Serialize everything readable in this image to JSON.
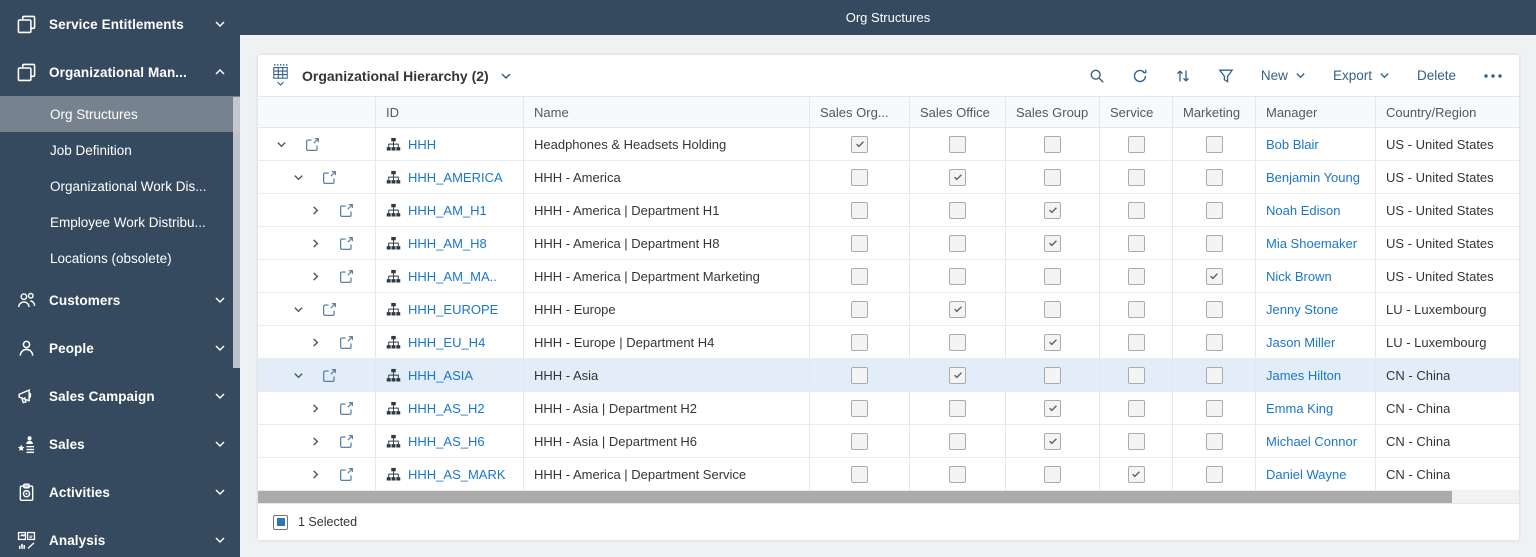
{
  "app": {
    "title": "Org Structures"
  },
  "colors": {
    "sidebar_bg": "#354A5F",
    "sidebar_selected": "#76838F",
    "topbar_bg": "#354A5F",
    "page_bg": "#F0F1F3",
    "link": "#1B77C8",
    "toolbar_accent": "#346187",
    "selected_row": "#E3EDF7",
    "border": "#E5E8EA",
    "text": "#32363A",
    "header_text": "#51585F",
    "check": "#54636D"
  },
  "sidebar": {
    "items": [
      {
        "label": "Service Entitlements",
        "icon": "documents",
        "expanded": false
      },
      {
        "label": "Organizational Man...",
        "icon": "documents",
        "expanded": true,
        "children": [
          {
            "label": "Org Structures",
            "selected": true
          },
          {
            "label": "Job Definition"
          },
          {
            "label": "Organizational Work Dis..."
          },
          {
            "label": "Employee Work Distribu..."
          },
          {
            "label": "Locations (obsolete)"
          }
        ]
      },
      {
        "label": "Customers",
        "icon": "customers",
        "expanded": false
      },
      {
        "label": "People",
        "icon": "person",
        "expanded": false
      },
      {
        "label": "Sales Campaign",
        "icon": "megaphone",
        "expanded": false
      },
      {
        "label": "Sales",
        "icon": "sales",
        "expanded": false
      },
      {
        "label": "Activities",
        "icon": "clipboard",
        "expanded": false
      },
      {
        "label": "Analysis",
        "icon": "analysis",
        "expanded": false
      }
    ]
  },
  "toolbar": {
    "view_switch_icon": "grid-view",
    "view_title": "Organizational Hierarchy (2)",
    "icon_buttons": [
      "search",
      "refresh",
      "sort",
      "filter"
    ],
    "new_label": "New",
    "export_label": "Export",
    "delete_label": "Delete",
    "overflow_icon": "overflow"
  },
  "table": {
    "columns": [
      "ID",
      "Name",
      "Sales Org...",
      "Sales Office",
      "Sales Group",
      "Service",
      "Marketing",
      "Manager",
      "Country/Region"
    ],
    "check_columns": [
      "Sales Org...",
      "Sales Office",
      "Sales Group",
      "Service",
      "Marketing"
    ],
    "row_icons": {
      "type": "org-chart",
      "open": "open-external"
    },
    "rows": [
      {
        "id": "HHH",
        "name": "Headphones & Headsets Holding",
        "level": 0,
        "expanded": true,
        "checked": 0,
        "manager": "Bob Blair",
        "country": "US - United States",
        "selected": false
      },
      {
        "id": "HHH_AMERICA",
        "name": "HHH - America",
        "level": 1,
        "expanded": true,
        "checked": 1,
        "manager": "Benjamin Young",
        "country": "US - United States",
        "selected": false
      },
      {
        "id": "HHH_AM_H1",
        "name": "HHH - America | Department H1",
        "level": 2,
        "expanded": false,
        "checked": 2,
        "manager": "Noah Edison",
        "country": "US - United States",
        "selected": false
      },
      {
        "id": "HHH_AM_H8",
        "name": "HHH - America | Department H8",
        "level": 2,
        "expanded": false,
        "checked": 2,
        "manager": "Mia Shoemaker",
        "country": "US - United States",
        "selected": false
      },
      {
        "id": "HHH_AM_MA..",
        "name": "HHH - America | Department Marketing",
        "level": 2,
        "expanded": false,
        "checked": 4,
        "manager": "Nick Brown",
        "country": "US - United States",
        "selected": false
      },
      {
        "id": "HHH_EUROPE",
        "name": "HHH - Europe",
        "level": 1,
        "expanded": true,
        "checked": 1,
        "manager": "Jenny Stone",
        "country": "LU - Luxembourg",
        "selected": false
      },
      {
        "id": "HHH_EU_H4",
        "name": "HHH - Europe | Department H4",
        "level": 2,
        "expanded": false,
        "checked": 2,
        "manager": "Jason Miller",
        "country": "LU - Luxembourg",
        "selected": false
      },
      {
        "id": "HHH_ASIA",
        "name": "HHH - Asia",
        "level": 1,
        "expanded": true,
        "checked": 1,
        "manager": "James Hilton",
        "country": "CN - China",
        "selected": true
      },
      {
        "id": "HHH_AS_H2",
        "name": "HHH - Asia | Department H2",
        "level": 2,
        "expanded": false,
        "checked": 2,
        "manager": "Emma King",
        "country": "CN - China",
        "selected": false
      },
      {
        "id": "HHH_AS_H6",
        "name": "HHH - Asia | Department H6",
        "level": 2,
        "expanded": false,
        "checked": 2,
        "manager": "Michael Connor",
        "country": "CN - China",
        "selected": false
      },
      {
        "id": "HHH_AS_MARK",
        "name": "HHH - America | Department Service",
        "level": 2,
        "expanded": false,
        "checked": 3,
        "manager": "Daniel Wayne",
        "country": "CN - China",
        "selected": false
      }
    ]
  },
  "footer": {
    "selected_text": "1 Selected"
  }
}
